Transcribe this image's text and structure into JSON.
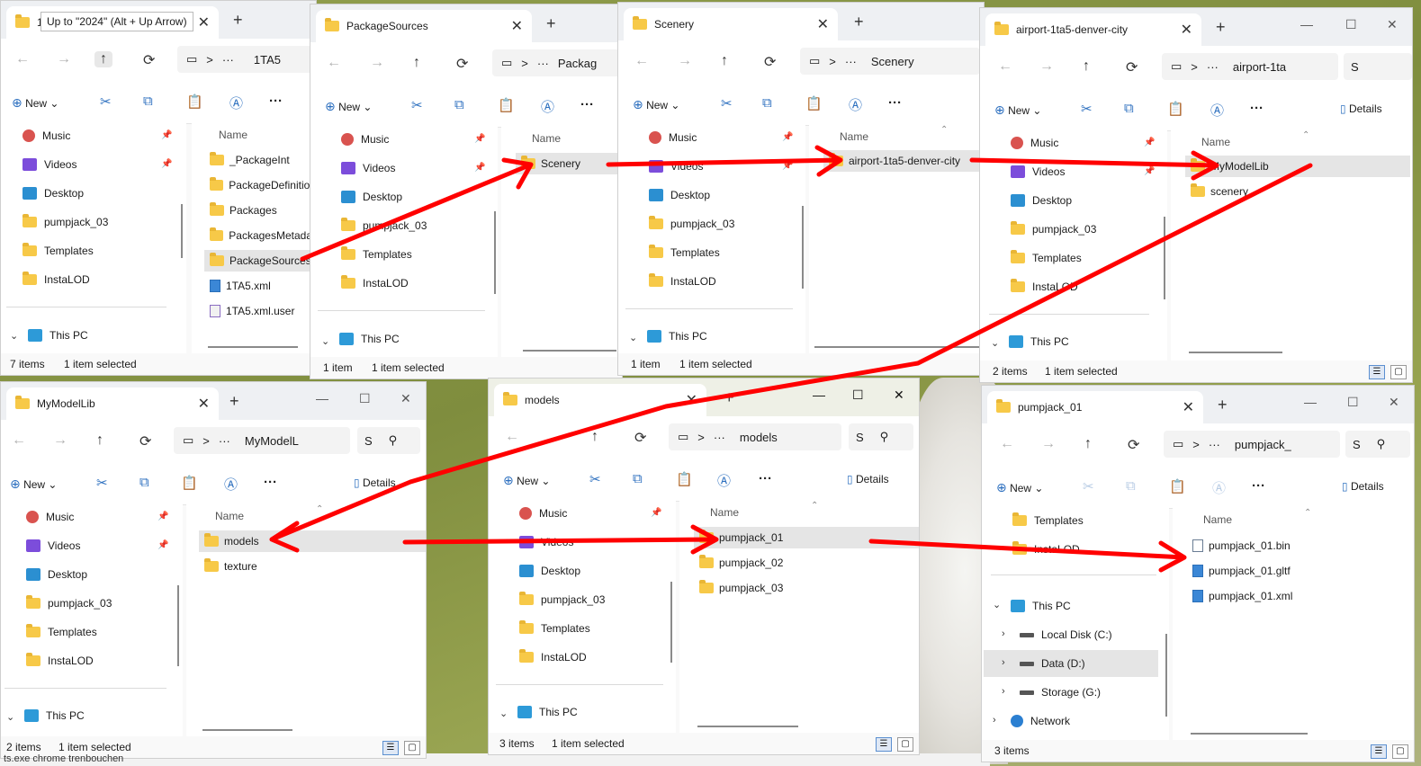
{
  "common": {
    "new_label": "New",
    "details_label": "Details",
    "name_col": "Name",
    "sidebar": [
      "Music",
      "Videos",
      "Desktop",
      "pumpjack_03",
      "Templates",
      "InstaLOD"
    ],
    "this_pc": "This PC",
    "ellipsis": "···",
    "chevron": ">"
  },
  "w1": {
    "tab_title": "1",
    "tooltip": "Up to \"2024\" (Alt + Up Arrow)",
    "path": "1TA5",
    "files": [
      "_PackageInt",
      "PackageDefinitions",
      "Packages",
      "PackagesMetadata",
      "PackageSources",
      "1TA5.xml",
      "1TA5.xml.user"
    ],
    "status_count": "7 items",
    "status_sel": "1 item selected"
  },
  "w2": {
    "tab_title": "PackageSources",
    "path": "Packag",
    "files": [
      "Scenery"
    ],
    "status_count": "1 item",
    "status_sel": "1 item selected"
  },
  "w3": {
    "tab_title": "Scenery",
    "path": "Scenery",
    "files": [
      "airport-1ta5-denver-city"
    ],
    "status_count": "1 item",
    "status_sel": "1 item selected"
  },
  "w4": {
    "tab_title": "airport-1ta5-denver-city",
    "path": "airport-1ta",
    "search": "S",
    "files": [
      "MyModelLib",
      "scenery"
    ],
    "status_count": "2 items",
    "status_sel": "1 item selected"
  },
  "w5": {
    "tab_title": "MyModelLib",
    "path": "MyModelL",
    "search": "S",
    "files": [
      "models",
      "texture"
    ],
    "status_count": "2 items",
    "status_sel": "1 item selected"
  },
  "w6": {
    "tab_title": "models",
    "path": "models",
    "search": "S",
    "files": [
      "pumpjack_01",
      "pumpjack_02",
      "pumpjack_03"
    ],
    "status_count": "3 items",
    "status_sel": "1 item selected"
  },
  "w7": {
    "tab_title": "pumpjack_01",
    "path": "pumpjack_",
    "search": "S",
    "sidebar": [
      "Templates",
      "InstaLOD",
      "This PC",
      "Local Disk (C:)",
      "Data (D:)",
      "Storage (G:)",
      "Network"
    ],
    "files": [
      "pumpjack_01.bin",
      "pumpjack_01.gltf",
      "pumpjack_01.xml"
    ],
    "status_count": "3 items"
  },
  "taskbar_text": "ts.exe  chrome  trenbouchen"
}
